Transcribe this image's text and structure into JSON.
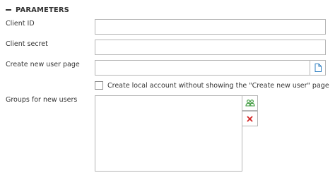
{
  "section": {
    "title": "PARAMETERS",
    "collapse_icon": "minus-icon"
  },
  "fields": {
    "client_id": {
      "label": "Client ID",
      "value": ""
    },
    "client_secret": {
      "label": "Client secret",
      "value": ""
    },
    "create_user_page": {
      "label": "Create new user page",
      "value": "",
      "button_icon": "page-icon"
    }
  },
  "checkbox": {
    "label": "Create local account without showing the \"Create new user\" page",
    "checked": false
  },
  "groups": {
    "label": "Groups for new users",
    "items": [],
    "add_button_icon": "add-group-icon",
    "remove_button_icon": "remove-icon",
    "add_icon_color": "#3c9a3c",
    "remove_icon_color": "#d42a2a"
  }
}
